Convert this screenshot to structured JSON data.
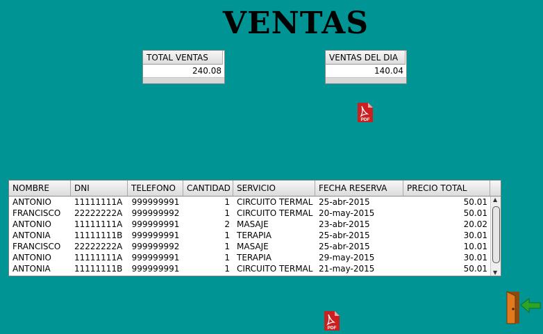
{
  "title": "VENTAS",
  "total_ventas": {
    "header": "TOTAL VENTAS",
    "value": "240.08"
  },
  "ventas_del_dia": {
    "header": "VENTAS DEL DIA",
    "value": "140.04"
  },
  "pdf_label": "PDF",
  "table": {
    "columns": [
      "NOMBRE",
      "DNI",
      "TELEFONO",
      "CANTIDAD",
      "SERVICIO",
      "FECHA RESERVA",
      "PRECIO TOTAL"
    ],
    "rows": [
      [
        "ANTONIO",
        "11111111A",
        "999999991",
        "1",
        "CIRCUITO TERMAL",
        "25-abr-2015",
        "50.01"
      ],
      [
        "FRANCISCO",
        "22222222A",
        "999999992",
        "1",
        "CIRCUITO TERMAL",
        "20-may-2015",
        "50.01"
      ],
      [
        "ANTONIO",
        "11111111A",
        "999999991",
        "2",
        "MASAJE",
        "23-abr-2015",
        "20.02"
      ],
      [
        "ANTONIA",
        "11111111B",
        "999999991",
        "1",
        "TERAPIA",
        "25-abr-2015",
        "30.01"
      ],
      [
        "FRANCISCO",
        "22222222A",
        "999999992",
        "1",
        "MASAJE",
        "25-abr-2015",
        "10.01"
      ],
      [
        "ANTONIO",
        "11111111A",
        "999999991",
        "1",
        "TERAPIA",
        "29-may-2015",
        "30.01"
      ],
      [
        "ANTONIA",
        "11111111B",
        "999999991",
        "1",
        "CIRCUITO TERMAL",
        "21-may-2015",
        "50.01"
      ]
    ]
  },
  "icons": {
    "pdf": "pdf-file-icon",
    "exit": "exit-door-icon"
  },
  "colors": {
    "background": "#009494",
    "pdf_red": "#cc1f1f",
    "exit_green": "#2aa52a"
  }
}
